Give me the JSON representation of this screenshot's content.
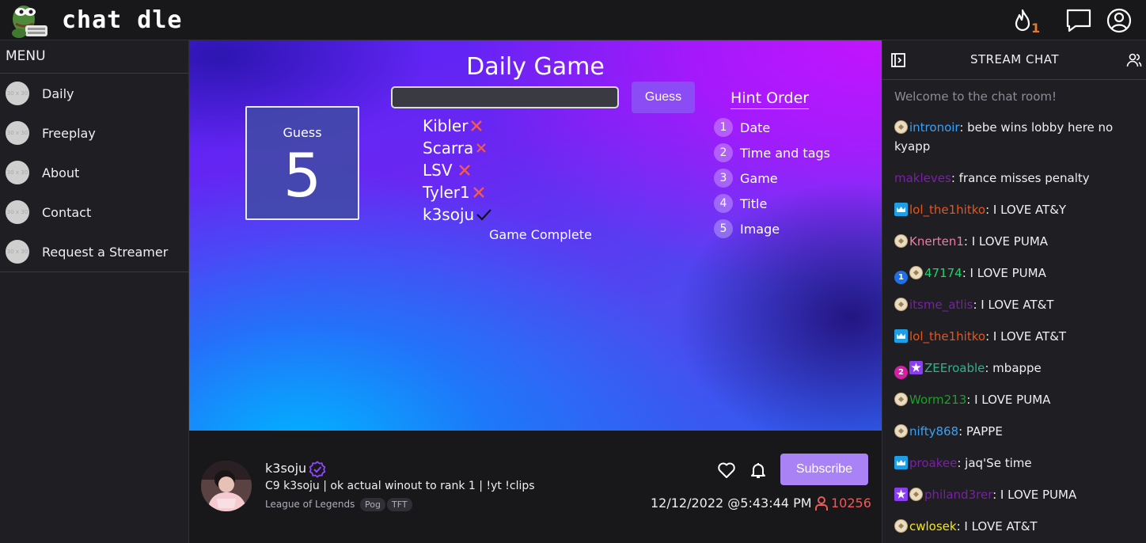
{
  "app": {
    "brand": "chat dle",
    "streak_count": "1"
  },
  "menu": {
    "title": "MENU",
    "avatar_placeholder": "30 x 30",
    "items": [
      {
        "label": "Daily"
      },
      {
        "label": "Freeplay"
      },
      {
        "label": "About"
      },
      {
        "label": "Contact"
      },
      {
        "label": "Request a Streamer"
      }
    ]
  },
  "game": {
    "title": "Daily Game",
    "input_value": "",
    "guess_button": "Guess",
    "guess_box_label": "Guess",
    "guess_number": "5",
    "guesses": [
      {
        "name": "Kibler",
        "result": "wrong"
      },
      {
        "name": "Scarra",
        "result": "wrong"
      },
      {
        "name": "LSV",
        "result": "wrong"
      },
      {
        "name": "Tyler1",
        "result": "wrong"
      },
      {
        "name": "k3soju",
        "result": "correct"
      }
    ],
    "status": "Game Complete",
    "hint_title": "Hint Order",
    "hints": [
      {
        "num": "1",
        "label": "Date"
      },
      {
        "num": "2",
        "label": "Time and tags"
      },
      {
        "num": "3",
        "label": "Game"
      },
      {
        "num": "4",
        "label": "Title"
      },
      {
        "num": "5",
        "label": "Image"
      }
    ]
  },
  "stream": {
    "streamer": "k3soju",
    "title": "C9 k3soju | ok actual winout to rank 1 | !yt !clips",
    "category": "League of Legends",
    "tags": [
      "Pog",
      "TFT"
    ],
    "subscribe_label": "Subscribe",
    "timestamp": "12/12/2022  @5:43:44 PM",
    "viewers": "10256"
  },
  "chat": {
    "title": "STREAM CHAT",
    "welcome": "Welcome to the chat room!",
    "messages": [
      {
        "badges": [
          "gold"
        ],
        "user": "intronoir",
        "color": "#3aa0f5",
        "text": ": bebe wins lobby here no kyapp"
      },
      {
        "badges": [],
        "user": "makleves",
        "color": "#7a1fa6",
        "text": ": france misses penalty"
      },
      {
        "badges": [
          "crown"
        ],
        "user": "lol_the1hitko",
        "color": "#e8541a",
        "text": ": I LOVE AT&Y"
      },
      {
        "badges": [
          "gold"
        ],
        "user": "Knerten1",
        "color": "#f07ca0",
        "text": ": I LOVE PUMA"
      },
      {
        "badges": [
          "one",
          "gold"
        ],
        "user": "47174",
        "color": "#23d16a",
        "text": ": I LOVE PUMA"
      },
      {
        "badges": [
          "gold"
        ],
        "user": "itsme_atlis",
        "color": "#7a1fa6",
        "text": ": I LOVE AT&T"
      },
      {
        "badges": [
          "crown"
        ],
        "user": "lol_the1hitko",
        "color": "#e8541a",
        "text": ": I LOVE AT&T"
      },
      {
        "badges": [
          "two",
          "star"
        ],
        "user": "ZEEroable",
        "color": "#2fb38e",
        "text": ": mbappe"
      },
      {
        "badges": [
          "gold"
        ],
        "user": "Worm213",
        "color": "#1f9e2a",
        "text": ": I LOVE PUMA"
      },
      {
        "badges": [
          "gold"
        ],
        "user": "nifty868",
        "color": "#3aa0f5",
        "text": ": PAPPE"
      },
      {
        "badges": [
          "crown"
        ],
        "user": "proakee",
        "color": "#7a1fa6",
        "text": ": jaq'Se time"
      },
      {
        "badges": [
          "star",
          "gold"
        ],
        "user": "philand3rer",
        "color": "#7a1fa6",
        "text": ": I LOVE PUMA"
      },
      {
        "badges": [
          "gold"
        ],
        "user": "cwlosek",
        "color": "#f5e51a",
        "text": ": I LOVE AT&T"
      }
    ]
  },
  "colors": {
    "accent": "#8b4cf5",
    "subscribe": "#a983f5",
    "wrong": "#f25a4a",
    "viewers": "#eb5b5b"
  }
}
